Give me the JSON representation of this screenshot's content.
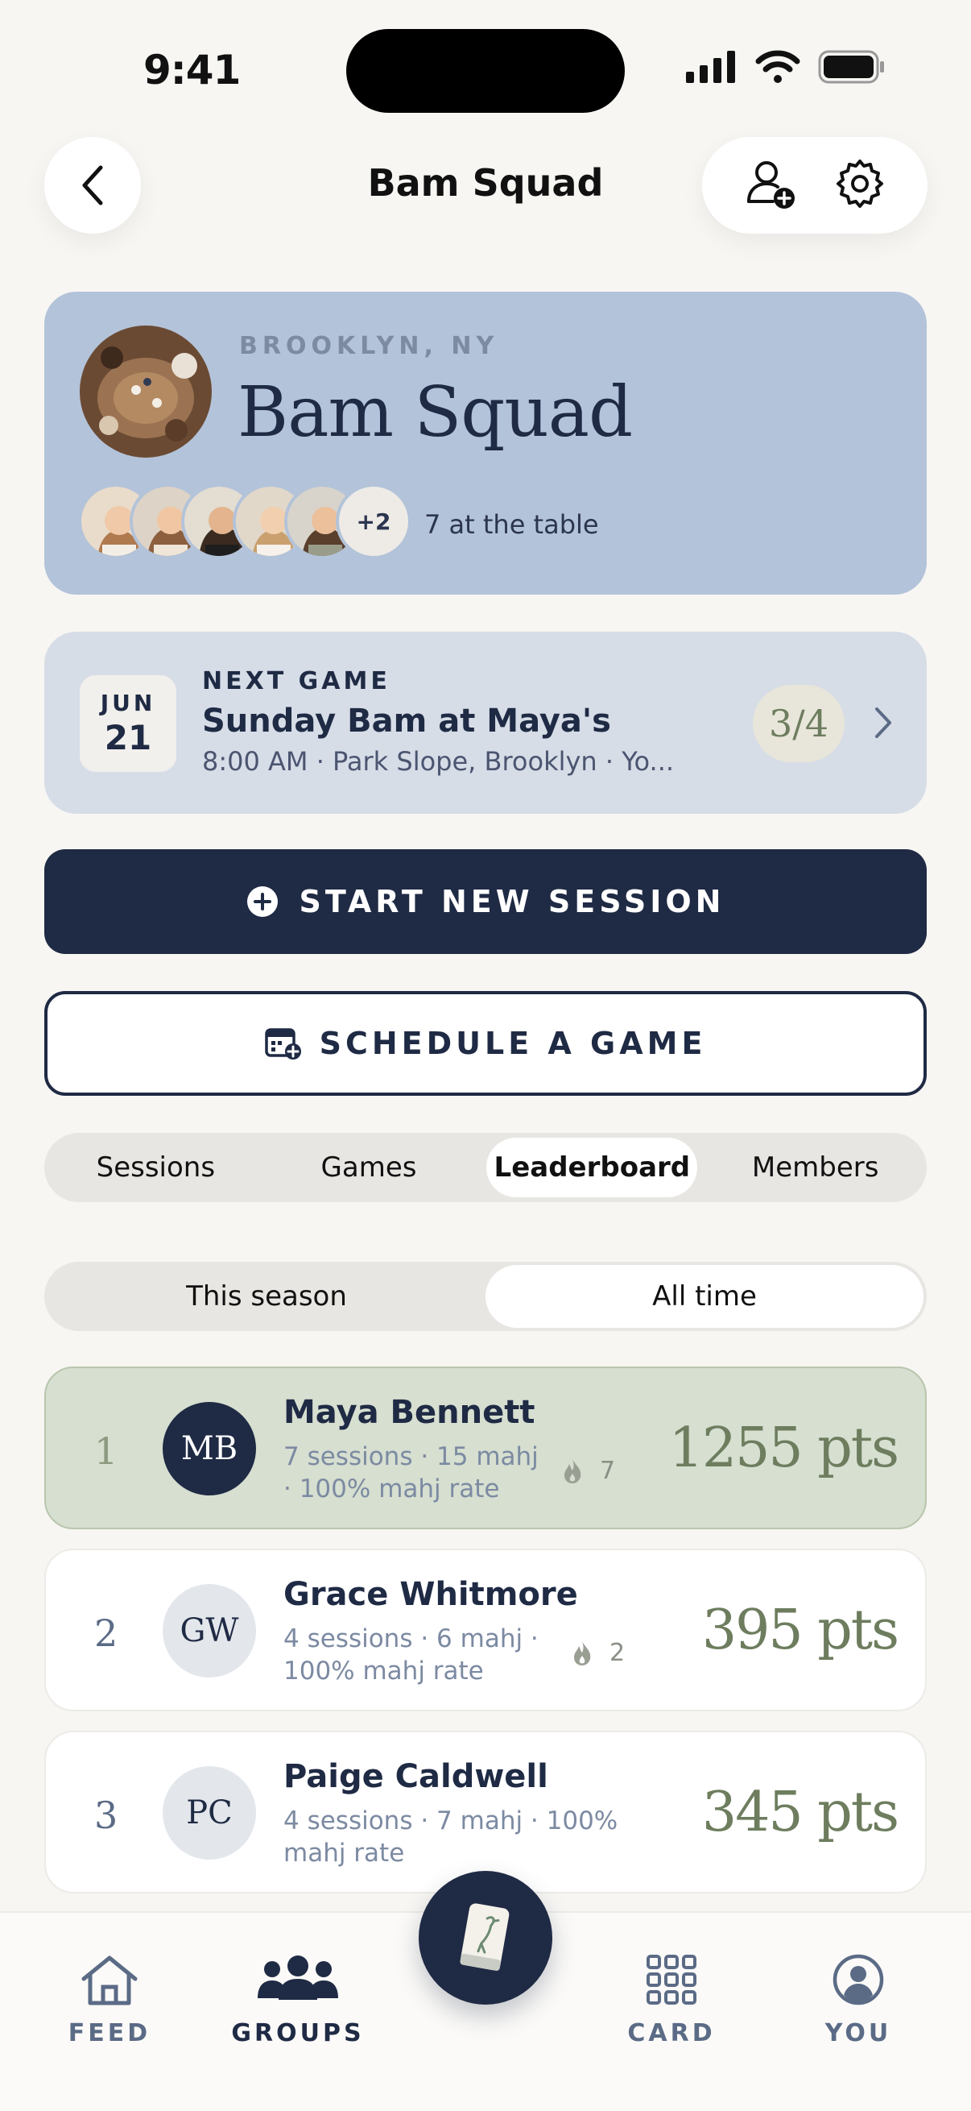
{
  "status": {
    "time": "9:41"
  },
  "header": {
    "title": "Bam Squad"
  },
  "group": {
    "location": "BROOKLYN, NY",
    "name": "Bam Squad",
    "extra_members": "+2",
    "table_count": "7 at the table"
  },
  "next_game": {
    "month": "JUN",
    "day": "21",
    "label": "NEXT GAME",
    "title": "Sunday Bam at Maya's",
    "subtitle": "8:00 AM · Park Slope, Brooklyn · Yo...",
    "rsvp": "3/4"
  },
  "actions": {
    "start": "START NEW SESSION",
    "schedule": "SCHEDULE A GAME"
  },
  "tabs": [
    "Sessions",
    "Games",
    "Leaderboard",
    "Members"
  ],
  "season_toggle": [
    "This season",
    "All time"
  ],
  "leaderboard": [
    {
      "rank": "1",
      "initials": "MB",
      "name": "Maya Bennett",
      "stats": "7 sessions · 15 mahj · 100% mahj rate",
      "streak": "7",
      "points": "1255 pts"
    },
    {
      "rank": "2",
      "initials": "GW",
      "name": "Grace Whitmore",
      "stats": "4 sessions · 6 mahj · 100% mahj rate",
      "streak": "2",
      "points": "395 pts"
    },
    {
      "rank": "3",
      "initials": "PC",
      "name": "Paige Caldwell",
      "stats": "4 sessions · 7 mahj · 100% mahj rate",
      "streak": "",
      "points": "345 pts"
    }
  ],
  "nav": {
    "feed": "FEED",
    "groups": "GROUPS",
    "card": "CARD",
    "you": "YOU"
  }
}
